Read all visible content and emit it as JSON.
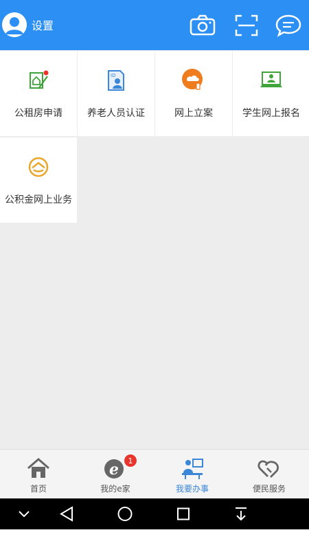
{
  "header": {
    "settings_label": "设置",
    "icons": [
      "camera-icon",
      "scan-icon",
      "message-icon"
    ],
    "bg_color": "#2b8ff3"
  },
  "services": [
    {
      "label": "公租房申请",
      "icon": "housing-application-icon"
    },
    {
      "label": "养老人员认证",
      "icon": "pension-certification-icon"
    },
    {
      "label": "网上立案",
      "icon": "online-filing-icon"
    },
    {
      "label": "学生网上报名",
      "icon": "student-enrollment-icon"
    },
    {
      "label": "公积金网上业务",
      "icon": "provident-fund-icon"
    }
  ],
  "tabs": [
    {
      "label": "首页",
      "icon": "home-icon",
      "active": false
    },
    {
      "label": "我的e家",
      "icon": "e-home-icon",
      "active": false,
      "badge": "1"
    },
    {
      "label": "我要办事",
      "icon": "service-desk-icon",
      "active": true
    },
    {
      "label": "便民服务",
      "icon": "heart-handshake-icon",
      "active": false
    }
  ],
  "system_nav": [
    "collapse-icon",
    "back-icon",
    "home-circle-icon",
    "recents-icon",
    "notification-pull-icon"
  ],
  "colors": {
    "accent": "#2b8ff3",
    "active_tab": "#3a86d8",
    "badge": "#e8352d",
    "green_icon": "#3fa53a",
    "orange_icon": "#ef7d1e"
  }
}
